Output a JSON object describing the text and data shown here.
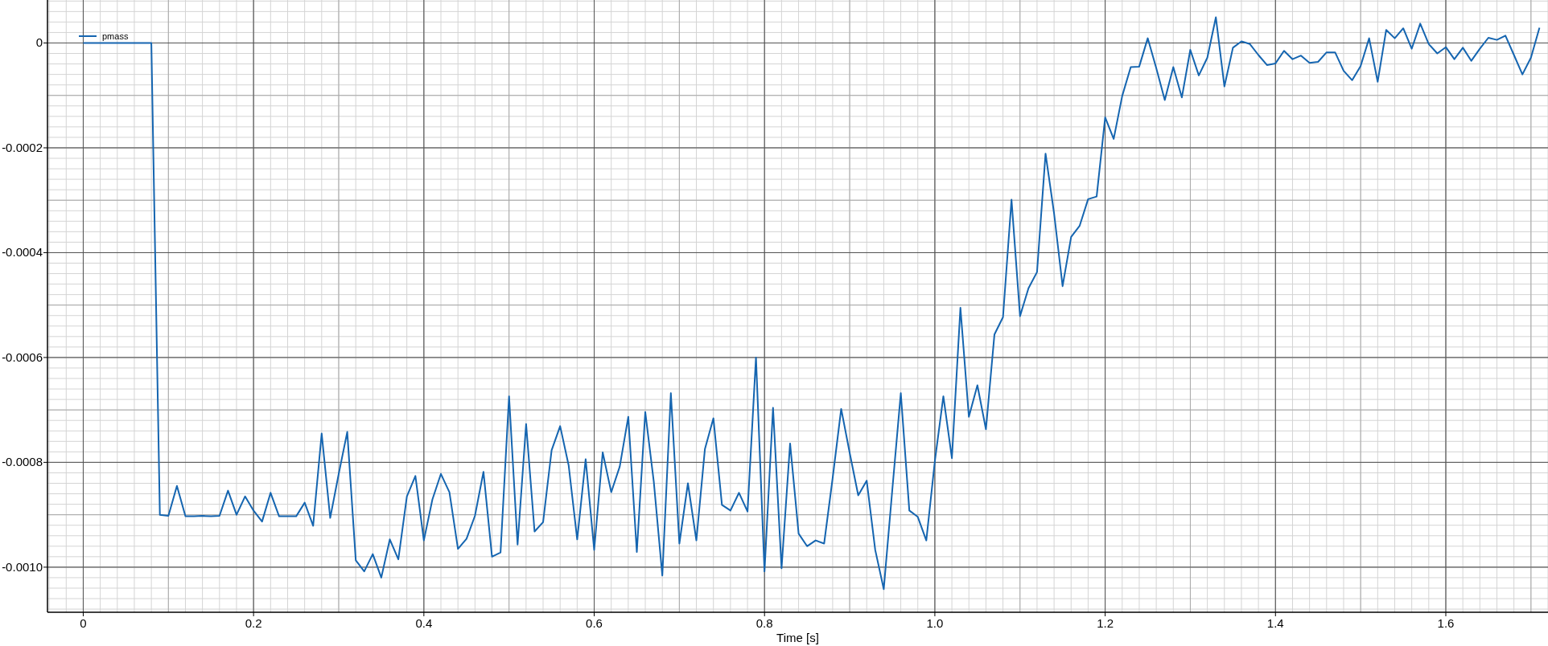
{
  "chart_data": {
    "type": "line",
    "xlabel": "Time [s]",
    "grid": true,
    "x": [
      0,
      0.01,
      0.02,
      0.03,
      0.04,
      0.05,
      0.06,
      0.07,
      0.08,
      0.09,
      0.1,
      0.11,
      0.12,
      0.13,
      0.14,
      0.15,
      0.16,
      0.17,
      0.18,
      0.19,
      0.2,
      0.21,
      0.22,
      0.23,
      0.24,
      0.25,
      0.26,
      0.27,
      0.28,
      0.29,
      0.3,
      0.31,
      0.32,
      0.33,
      0.34,
      0.35,
      0.36,
      0.37,
      0.38,
      0.39,
      0.4,
      0.41,
      0.42,
      0.43,
      0.44,
      0.45,
      0.46,
      0.47,
      0.48,
      0.49,
      0.5,
      0.51,
      0.52,
      0.53,
      0.54,
      0.55,
      0.56,
      0.57,
      0.58,
      0.59,
      0.6,
      0.61,
      0.62,
      0.63,
      0.64,
      0.65,
      0.66,
      0.67,
      0.68,
      0.69,
      0.7,
      0.71,
      0.72,
      0.73,
      0.74,
      0.75,
      0.76,
      0.77,
      0.78,
      0.79,
      0.8,
      0.81,
      0.82,
      0.83,
      0.84,
      0.85,
      0.86,
      0.87,
      0.88,
      0.89,
      0.9,
      0.91,
      0.92,
      0.93,
      0.94,
      0.95,
      0.96,
      0.97,
      0.98,
      0.99,
      1,
      1.01,
      1.02,
      1.03,
      1.04,
      1.05,
      1.06,
      1.07,
      1.08,
      1.09,
      1.1,
      1.11,
      1.12,
      1.13,
      1.14,
      1.15,
      1.16,
      1.17,
      1.18,
      1.19,
      1.2,
      1.21,
      1.22,
      1.23,
      1.24,
      1.25,
      1.26,
      1.27,
      1.28,
      1.29,
      1.3,
      1.31,
      1.32,
      1.33,
      1.34,
      1.35,
      1.36,
      1.37,
      1.38,
      1.39,
      1.4,
      1.41,
      1.42,
      1.43,
      1.44,
      1.45,
      1.46,
      1.47,
      1.48,
      1.49,
      1.5,
      1.51,
      1.52,
      1.53,
      1.54,
      1.55,
      1.56,
      1.57,
      1.58,
      1.59,
      1.6,
      1.61,
      1.62,
      1.63,
      1.64,
      1.65,
      1.66,
      1.67,
      1.68,
      1.69,
      1.7,
      1.71
    ],
    "series": [
      {
        "name": "pmass",
        "color": "#1565b0",
        "values": [
          0,
          0,
          0,
          0,
          0,
          0,
          0,
          0,
          0,
          -0.0009,
          -0.000902,
          -0.000845,
          -0.000903,
          -0.000903,
          -0.000902,
          -0.000903,
          -0.000902,
          -0.000854,
          -0.0009,
          -0.000865,
          -0.000892,
          -0.000913,
          -0.000858,
          -0.000903,
          -0.000903,
          -0.000903,
          -0.000877,
          -0.000921,
          -0.000745,
          -0.000906,
          -0.000822,
          -0.000742,
          -0.000987,
          -0.001008,
          -0.000975,
          -0.00102,
          -0.000947,
          -0.000985,
          -0.000865,
          -0.000826,
          -0.000949,
          -0.000871,
          -0.000822,
          -0.000857,
          -0.000965,
          -0.000946,
          -0.000902,
          -0.000818,
          -0.00098,
          -0.000972,
          -0.000674,
          -0.000957,
          -0.000727,
          -0.000932,
          -0.000914,
          -0.000777,
          -0.000731,
          -0.000806,
          -0.000947,
          -0.000794,
          -0.000967,
          -0.000781,
          -0.000857,
          -0.000808,
          -0.000713,
          -0.000971,
          -0.000704,
          -0.000837,
          -0.001016,
          -0.000668,
          -0.000955,
          -0.00084,
          -0.000949,
          -0.000775,
          -0.000716,
          -0.000881,
          -0.000892,
          -0.000858,
          -0.000894,
          -0.0006,
          -0.001008,
          -0.000696,
          -0.001002,
          -0.000764,
          -0.000936,
          -0.00096,
          -0.000949,
          -0.000955,
          -0.00083,
          -0.000698,
          -0.000782,
          -0.000863,
          -0.000835,
          -0.000967,
          -0.001042,
          -0.000853,
          -0.000668,
          -0.000892,
          -0.000904,
          -0.000949,
          -0.000798,
          -0.000674,
          -0.000792,
          -0.000505,
          -0.000713,
          -0.000653,
          -0.000737,
          -0.000556,
          -0.000523,
          -0.000299,
          -0.000521,
          -0.000468,
          -0.000437,
          -0.000211,
          -0.000325,
          -0.000464,
          -0.00037,
          -0.000349,
          -0.000298,
          -0.000293,
          -0.000142,
          -0.000183,
          -0.000101,
          -4.6e-05,
          -4.5e-05,
          9e-06,
          -4.8e-05,
          -0.000109,
          -4.6e-05,
          -0.000104,
          -1.3e-05,
          -6.2e-05,
          -2.8e-05,
          4.9e-05,
          -8.3e-05,
          -9e-06,
          3e-06,
          -2e-06,
          -2.3e-05,
          -4.2e-05,
          -3.9e-05,
          -1.5e-05,
          -3.1e-05,
          -2.4e-05,
          -3.8e-05,
          -3.6e-05,
          -1.8e-05,
          -1.8e-05,
          -5.3e-05,
          -7.1e-05,
          -4.4e-05,
          9e-06,
          -7.4e-05,
          2.5e-05,
          9e-06,
          2.8e-05,
          -1.1e-05,
          3.7e-05,
          -2e-06,
          -2e-05,
          -8e-06,
          -3.1e-05,
          -9e-06,
          -3.4e-05,
          -1.1e-05,
          1e-05,
          6e-06,
          1.4e-05,
          -2.3e-05,
          -6e-05,
          -2.8e-05,
          2.9e-05
        ]
      }
    ],
    "xlim": [
      -0.042,
      1.72
    ],
    "ylim": [
      -0.001086,
      8.2e-05
    ],
    "xticks": [
      {
        "value": 0,
        "label": "0"
      },
      {
        "value": 0.2,
        "label": "0.2"
      },
      {
        "value": 0.4,
        "label": "0.4"
      },
      {
        "value": 0.6,
        "label": "0.6"
      },
      {
        "value": 0.8,
        "label": "0.8"
      },
      {
        "value": 1,
        "label": "1.0"
      },
      {
        "value": 1.2,
        "label": "1.2"
      },
      {
        "value": 1.4,
        "label": "1.4"
      },
      {
        "value": 1.6,
        "label": "1.6"
      }
    ],
    "yticks": [
      {
        "value": 0,
        "label": "0"
      },
      {
        "value": -0.0002,
        "label": "-0.0002"
      },
      {
        "value": -0.0004,
        "label": "-0.0004"
      },
      {
        "value": -0.0006,
        "label": "-0.0006"
      },
      {
        "value": -0.0008,
        "label": "-0.0008"
      },
      {
        "value": -0.001,
        "label": "-0.0010"
      }
    ]
  }
}
